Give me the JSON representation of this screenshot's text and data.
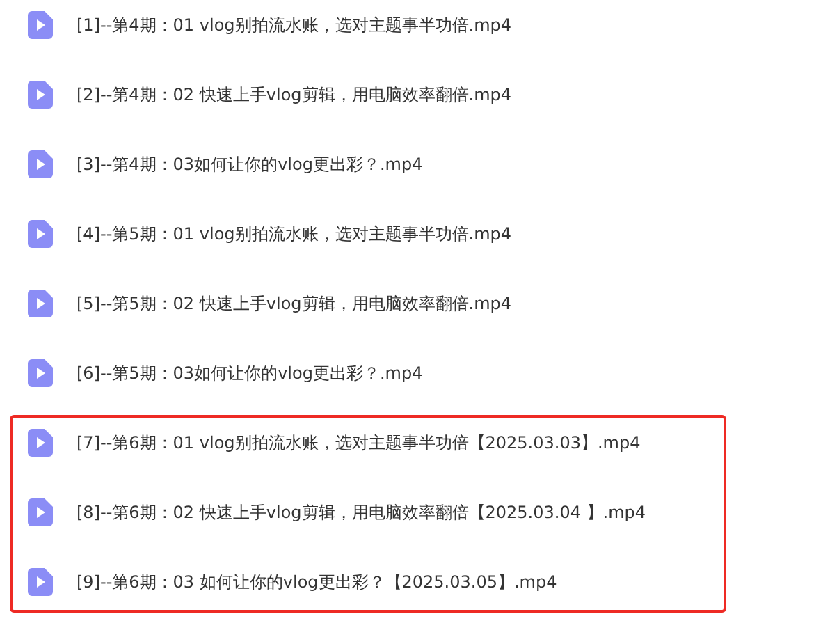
{
  "files": [
    {
      "name": "[1]--第4期：01 vlog别拍流水账，选对主题事半功倍.mp4"
    },
    {
      "name": "[2]--第4期：02 快速上手vlog剪辑，用电脑效率翻倍.mp4"
    },
    {
      "name": "[3]--第4期：03如何让你的vlog更出彩？.mp4"
    },
    {
      "name": "[4]--第5期：01 vlog别拍流水账，选对主题事半功倍.mp4"
    },
    {
      "name": "[5]--第5期：02 快速上手vlog剪辑，用电脑效率翻倍.mp4"
    },
    {
      "name": "[6]--第5期：03如何让你的vlog更出彩？.mp4"
    }
  ],
  "highlighted_files": [
    {
      "name": "[7]--第6期：01 vlog别拍流水账，选对主题事半功倍【2025.03.03】.mp4"
    },
    {
      "name": "[8]--第6期：02 快速上手vlog剪辑，用电脑效率翻倍【2025.03.04 】.mp4"
    },
    {
      "name": "[9]--第6期：03 如何让你的vlog更出彩？【2025.03.05】.mp4"
    }
  ]
}
